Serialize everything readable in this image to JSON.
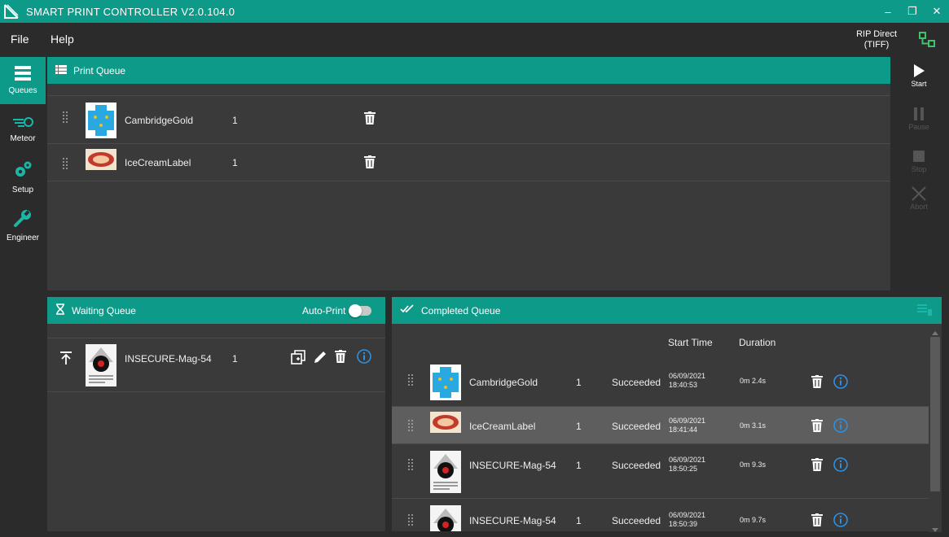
{
  "window": {
    "title": "SMART PRINT CONTROLLER V2.0.104.0"
  },
  "menu": {
    "file": "File",
    "help": "Help"
  },
  "rip": {
    "line1": "RIP Direct",
    "line2": "(TIFF)"
  },
  "nav": [
    {
      "label": "Queues",
      "icon": "list-icon",
      "active": true
    },
    {
      "label": "Meteor",
      "icon": "meteor-icon",
      "active": false
    },
    {
      "label": "Setup",
      "icon": "gears-icon",
      "active": false
    },
    {
      "label": "Engineer",
      "icon": "wrench-icon",
      "active": false
    }
  ],
  "controls": {
    "start": "Start",
    "pause": "Pause",
    "stop": "Stop",
    "abort": "Abort"
  },
  "print_queue": {
    "title": "Print Queue",
    "items": [
      {
        "name": "CambridgeGold",
        "qty": "1",
        "thumb": "blue-box"
      },
      {
        "name": "IceCreamLabel",
        "qty": "1",
        "thumb": "red-label"
      }
    ]
  },
  "waiting_queue": {
    "title": "Waiting Queue",
    "auto_print_label": "Auto-Print",
    "auto_print": false,
    "items": [
      {
        "name": "INSECURE-Mag-54",
        "qty": "1",
        "thumb": "magazine"
      }
    ]
  },
  "completed_queue": {
    "title": "Completed Queue",
    "columns": {
      "start_time": "Start Time",
      "duration": "Duration"
    },
    "items": [
      {
        "name": "CambridgeGold",
        "qty": "1",
        "status": "Succeeded",
        "date": "06/09/2021",
        "time": "18:40:53",
        "duration": "0m 2.4s",
        "thumb": "blue-box",
        "selected": false
      },
      {
        "name": "IceCreamLabel",
        "qty": "1",
        "status": "Succeeded",
        "date": "06/09/2021",
        "time": "18:41:44",
        "duration": "0m 3.1s",
        "thumb": "red-label",
        "selected": true
      },
      {
        "name": "INSECURE-Mag-54",
        "qty": "1",
        "status": "Succeeded",
        "date": "06/09/2021",
        "time": "18:50:25",
        "duration": "0m 9.3s",
        "thumb": "magazine",
        "selected": false
      },
      {
        "name": "INSECURE-Mag-54",
        "qty": "1",
        "status": "Succeeded",
        "date": "06/09/2021",
        "time": "18:50:39",
        "duration": "0m 9.7s",
        "thumb": "magazine",
        "selected": false
      }
    ]
  },
  "colors": {
    "accent": "#0e9a88",
    "info": "#2f8fe0",
    "selected_row": "#5e5e5e"
  }
}
